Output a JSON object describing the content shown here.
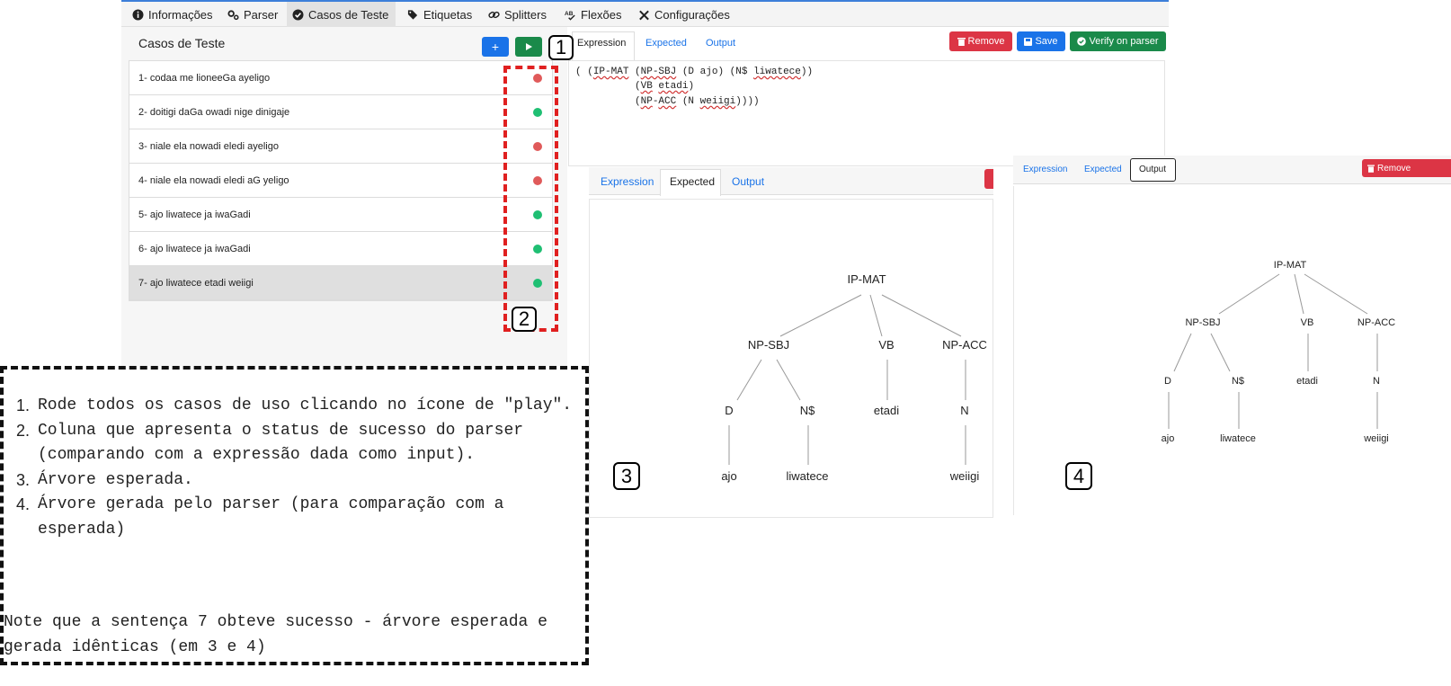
{
  "topnav": {
    "items": [
      {
        "label": "Informações",
        "icon": "info-icon"
      },
      {
        "label": "Parser",
        "icon": "gears-icon"
      },
      {
        "label": "Casos de Teste",
        "icon": "check-circle-icon"
      },
      {
        "label": "Etiquetas",
        "icon": "tags-icon"
      },
      {
        "label": "Splitters",
        "icon": "link-icon"
      },
      {
        "label": "Flexões",
        "icon": "spellcheck-icon"
      },
      {
        "label": "Configurações",
        "icon": "tools-icon"
      }
    ],
    "active": "Casos de Teste"
  },
  "test_cases": {
    "title": "Casos de Teste",
    "add_label": "+",
    "run_label": "▶",
    "items": [
      {
        "label": "1- codaa me lioneeGa ayeligo",
        "status": "fail"
      },
      {
        "label": "2- doitigi daGa owadi nige dinigaje",
        "status": "success"
      },
      {
        "label": "3- niale ela nowadi eledi ayeligo",
        "status": "fail"
      },
      {
        "label": "4- niale ela nowadi eledi aG yeligo",
        "status": "fail"
      },
      {
        "label": "5- ajo liwatece ja iwaGadi",
        "status": "success"
      },
      {
        "label": "6- ajo liwatece ja iwaGadi",
        "status": "success"
      },
      {
        "label": "7- ajo liwatece etadi weiigi",
        "status": "success"
      }
    ],
    "selected": 7
  },
  "editor": {
    "tabs": [
      "Expression",
      "Expected",
      "Output"
    ],
    "active_tab": "Expression",
    "remove_label": "Remove",
    "save_label": "Save",
    "verify_label": "Verify on parser",
    "code": {
      "l1_a": "( (",
      "l1_b": "IP-MAT",
      "l1_c": " (",
      "l1_d": "NP-SBJ",
      "l1_e": " (D ajo) (N$ ",
      "l1_f": "liwatece",
      "l1_g": "))",
      "l2_a": "(",
      "l2_b": "VB",
      "l2_c": " ",
      "l2_d": "etadi",
      "l2_e": ")",
      "l3_a": "(",
      "l3_b": "NP",
      "l3_c": "-",
      "l3_d": "ACC",
      "l3_e": " (N ",
      "l3_f": "weiigi",
      "l3_g": "))))"
    }
  },
  "expected_panel": {
    "tabs": [
      "Expression",
      "Expected",
      "Output"
    ],
    "active_tab": "Expected",
    "tree": {
      "root": "IP-MAT",
      "np_sbj": "NP-SBJ",
      "vb": "VB",
      "np_acc": "NP-ACC",
      "d": "D",
      "n_dollar": "N$",
      "vb_word": "etadi",
      "n": "N",
      "ajo": "ajo",
      "liwatece": "liwatece",
      "weiigi": "weiigi"
    }
  },
  "output_panel": {
    "tabs": [
      "Expression",
      "Expected",
      "Output"
    ],
    "active_tab": "Output",
    "remove_label": "Remove",
    "tree": {
      "root": "IP-MAT",
      "np_sbj": "NP-SBJ",
      "vb": "VB",
      "np_acc": "NP-ACC",
      "d": "D",
      "n_dollar": "N$",
      "vb_word": "etadi",
      "n": "N",
      "ajo": "ajo",
      "liwatece": "liwatece",
      "weiigi": "weiigi"
    }
  },
  "callouts": {
    "c1": "1",
    "c2": "2",
    "c3": "3",
    "c4": "4"
  },
  "instructions": {
    "steps": [
      "Rode todos os casos de uso clicando no ícone de \"play\".",
      "Coluna que apresenta o status de sucesso do parser (comparando com a expressão dada como input).",
      "Árvore esperada.",
      "Árvore gerada pelo parser (para comparação com a esperada)"
    ],
    "step_numbers": [
      "1.",
      "2.",
      "3.",
      "4."
    ],
    "note": "Note que a sentença 7 obteve sucesso - árvore esperada e gerada idênticas (em 3 e 4)"
  },
  "colors": {
    "success": "#1fbf73",
    "fail": "#e05a5a",
    "primary": "#1a73e8",
    "danger": "#dc3545",
    "green": "#1a8a4a"
  }
}
